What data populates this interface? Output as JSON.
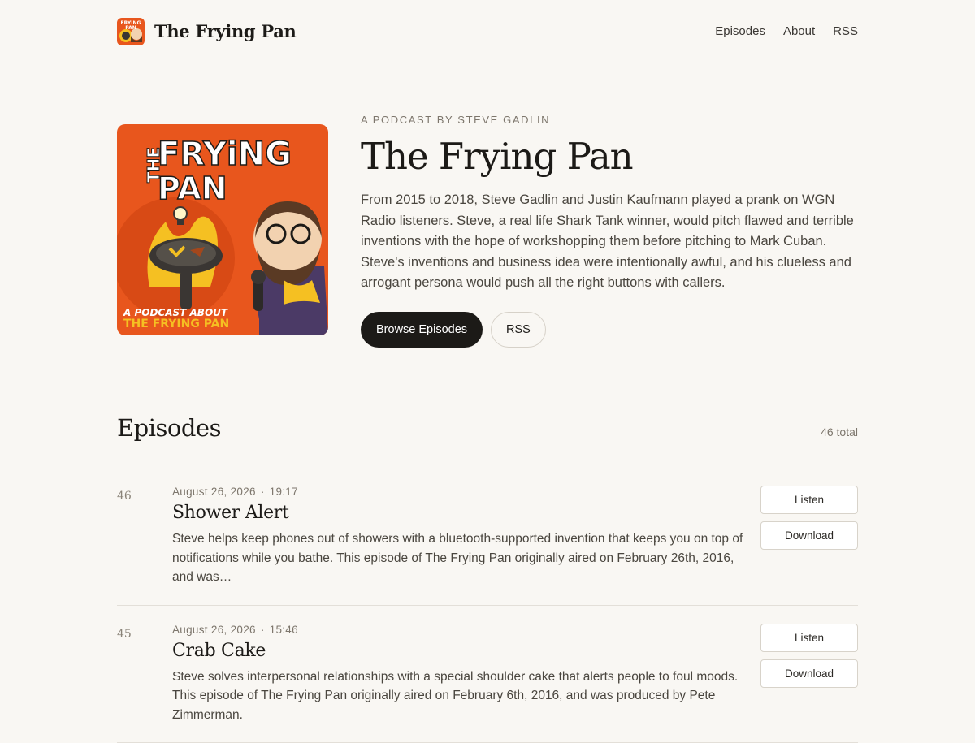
{
  "header": {
    "title": "The Frying Pan",
    "nav": [
      "Episodes",
      "About",
      "RSS"
    ]
  },
  "hero": {
    "kicker": "A PODCAST BY STEVE GADLIN",
    "title": "The Frying Pan",
    "description": "From 2015 to 2018, Steve Gadlin and Justin Kaufmann played a prank on WGN Radio listeners. Steve, a real life Shark Tank winner, would pitch flawed and terrible inventions with the hope of workshopping them before pitching to Mark Cuban. Steve's inventions and business idea were intentionally awful, and his clueless and arrogant persona would push all the right buttons with callers.",
    "browse_label": "Browse Episodes",
    "rss_label": "RSS",
    "cover_lines": [
      "THE",
      "FRYiNG",
      "PAN",
      "A PODCAST ABOUT",
      "THE FRYING PAN"
    ],
    "logo_lines": [
      "FRYING",
      "PAN"
    ]
  },
  "episodes": {
    "heading": "Episodes",
    "total": "46 total",
    "items": [
      {
        "number": "46",
        "date": "August 26, 2026",
        "duration": "19:17",
        "title": "Shower Alert",
        "description": "Steve helps keep phones out of showers with a bluetooth-supported invention that keeps you on top of notifications while you bathe. This episode of The Frying Pan originally aired on February 26th, 2016, and was…",
        "listen_label": "Listen",
        "download_label": "Download"
      },
      {
        "number": "45",
        "date": "August 26, 2026",
        "duration": "15:46",
        "title": "Crab Cake",
        "description": "Steve solves interpersonal relationships with a special shoulder cake that alerts people to foul moods. This episode of The Frying Pan originally aired on February 6th, 2016, and was produced by Pete Zimmerman.",
        "listen_label": "Listen",
        "download_label": "Download"
      }
    ]
  },
  "colors": {
    "background": "#f9f7f3",
    "text": "#1c1a17",
    "cover_orange": "#e8561d",
    "cover_yellow": "#f5c022"
  }
}
